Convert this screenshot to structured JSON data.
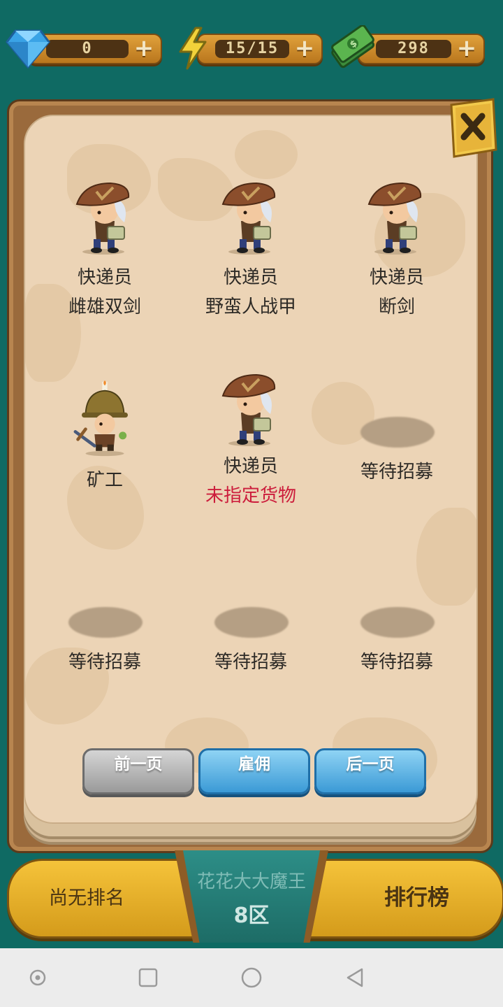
{
  "resources": {
    "gems": "0",
    "energy": "15/15",
    "cash": "298"
  },
  "workers": [
    {
      "name": "快递员",
      "detail": "雌雄双剑",
      "type": "courier"
    },
    {
      "name": "快递员",
      "detail": "野蛮人战甲",
      "type": "courier"
    },
    {
      "name": "快递员",
      "detail": "断剑",
      "type": "courier"
    },
    {
      "name": "矿工",
      "detail": "",
      "type": "miner"
    },
    {
      "name": "快递员",
      "detail": "未指定货物",
      "type": "courier",
      "warning": true
    },
    {
      "name": "等待招募",
      "detail": "",
      "type": "empty"
    },
    {
      "name": "等待招募",
      "detail": "",
      "type": "empty"
    },
    {
      "name": "等待招募",
      "detail": "",
      "type": "empty"
    },
    {
      "name": "等待招募",
      "detail": "",
      "type": "empty"
    }
  ],
  "buttons": {
    "prev": "前一页",
    "hire": "雇佣",
    "next": "后一页"
  },
  "bottom": {
    "rank": "尚无排名",
    "player_name": "花花大大魔王",
    "server": "8区",
    "leaderboard": "排行榜"
  },
  "colors": {
    "warning": "#cc1d3c",
    "paper": "#ecd4b6",
    "background": "#0f6a63"
  },
  "icons": [
    "gem-icon",
    "energy-icon",
    "cash-icon",
    "close-icon",
    "courier-icon",
    "miner-icon"
  ]
}
